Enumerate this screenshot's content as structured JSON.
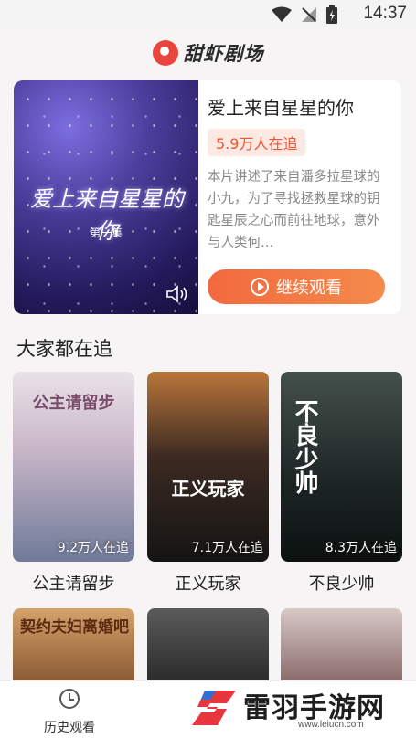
{
  "status_bar": {
    "time": "14:37"
  },
  "header": {
    "title": "甜虾剧场"
  },
  "hero": {
    "title": "爱上来自星星的你",
    "viewers": "5.9万人在追",
    "description": "本片讲述了来自潘多拉星球的小九，为了寻找拯救星球的钥匙星辰之心而前往地球，意外与人类何…",
    "poster_title": "爱上来自星星的你",
    "poster_episode": "第一集",
    "continue_label": "继续观看"
  },
  "section": {
    "title": "大家都在追"
  },
  "dramas": [
    {
      "name": "公主请留步",
      "viewers": "9.2万人在追",
      "poster_text": "公主请留步"
    },
    {
      "name": "正义玩家",
      "viewers": "7.1万人在追",
      "poster_text": "正义玩家"
    },
    {
      "name": "不良少帅",
      "viewers": "8.3万人在追",
      "poster_text": "不良少帅"
    }
  ],
  "row2_posters": [
    {
      "poster_text": "契约夫妇离婚吧"
    },
    {
      "poster_text": ""
    },
    {
      "poster_text": ""
    }
  ],
  "bottom_nav": {
    "history_label": "历史观看"
  },
  "watermark": {
    "text": "雷羽手游网",
    "url": "www.leiucn.com"
  },
  "colors": {
    "accent": "#f2693e",
    "badge_bg": "#fde9e3",
    "badge_text": "#f0552d"
  }
}
